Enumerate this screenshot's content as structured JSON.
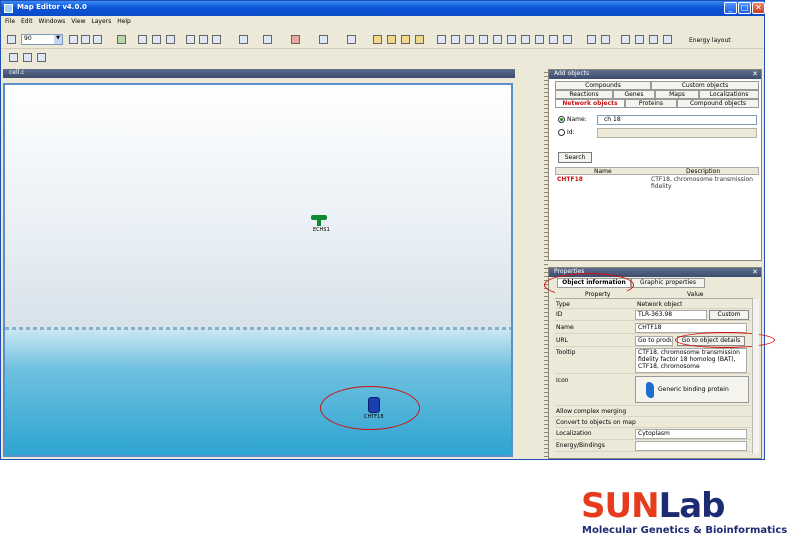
{
  "window": {
    "title": "Map Editor v4.0.0"
  },
  "window_buttons": {
    "minimize": "_",
    "maximize": "□",
    "close": "✕"
  },
  "menu": [
    "File",
    "Edit",
    "Windows",
    "View",
    "Layers",
    "Help"
  ],
  "toolbar": {
    "zoom_value": "90",
    "energy_label": "Energy layout"
  },
  "map": {
    "tab_label": "cell.c",
    "nodes": [
      {
        "label": "ECHS1"
      },
      {
        "label": "CHTF18"
      }
    ]
  },
  "search": {
    "title": "Add objects",
    "tabs_row1": [
      "Compounds",
      "Custom objects"
    ],
    "tabs_row2": [
      "Reactions",
      "Genes",
      "Maps",
      "Localizations"
    ],
    "tabs_row3": [
      "Network objects",
      "Proteins",
      "Compound objects"
    ],
    "name_label": "Name:",
    "name_value": "ch 18",
    "id_label": "Id:",
    "search_button": "Search",
    "columns": [
      "Name",
      "Description"
    ],
    "results": [
      {
        "name": "CHTF18",
        "description": "CTF18, chromosome transmission fidelity"
      }
    ]
  },
  "properties": {
    "title": "Properties",
    "tabs": [
      "Object information",
      "Graphic properties"
    ],
    "columns": [
      "Property",
      "Value"
    ],
    "rows": [
      {
        "key": "Type",
        "value": "Network object"
      },
      {
        "key": "ID",
        "value": "TLR-363.98",
        "button": "Custom"
      },
      {
        "key": "Name",
        "value": "CHTF18"
      },
      {
        "key": "URL",
        "value": "Go to product",
        "button": "Go to object details"
      },
      {
        "key": "Tooltip",
        "value": "CTF18, chromosome transmission fidelity factor 18 homolog (BAT), CTF18, chromosome"
      },
      {
        "key": "Icon",
        "value": "Generic binding protein"
      },
      {
        "key": "Allow complex merging",
        "value": ""
      },
      {
        "key": "Convert to objects on map",
        "value": ""
      },
      {
        "key": "Localization",
        "value": "Cytoplasm"
      },
      {
        "key": "Energy/Bindings",
        "value": ""
      }
    ]
  },
  "logo": {
    "text_sun": "SUN",
    "text_lab": "Lab",
    "subtitle": "Molecular Genetics & Bioinformatics"
  },
  "colors": {
    "title_bar": "#0a53d6",
    "accent_red": "#c31212",
    "logo_blue": "#1c2b72",
    "logo_orange": "#e63b1c"
  }
}
